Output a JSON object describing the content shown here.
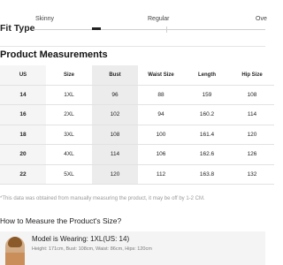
{
  "fit_type": {
    "label": "Fit Type",
    "options": [
      "Skinny",
      "Regular",
      "Ove"
    ]
  },
  "product_measurements": {
    "title": "Product Measurements",
    "columns": [
      "US",
      "Size",
      "Bust",
      "Waist Size",
      "Length",
      "Hip Size"
    ],
    "rows": [
      [
        "14",
        "1XL",
        "96",
        "88",
        "159",
        "108"
      ],
      [
        "16",
        "2XL",
        "102",
        "94",
        "160.2",
        "114"
      ],
      [
        "18",
        "3XL",
        "108",
        "100",
        "161.4",
        "120"
      ],
      [
        "20",
        "4XL",
        "114",
        "106",
        "162.6",
        "126"
      ],
      [
        "22",
        "5XL",
        "120",
        "112",
        "163.8",
        "132"
      ]
    ],
    "note": "*This data was obtained from manually measuring the product, it may be off by 1-2 CM."
  },
  "how_to_measure": {
    "title": "How to Measure the Product's Size?"
  },
  "model": {
    "wearing": "Model is Wearing: 1XL(US: 14)",
    "stats": "Height: 171cm, Bust: 108cm, Waist: 86cm, Hips: 120cm"
  }
}
